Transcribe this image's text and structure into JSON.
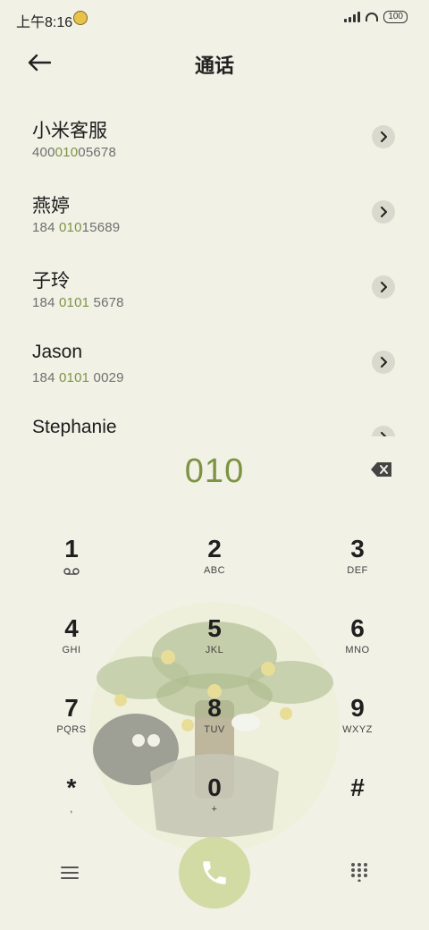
{
  "status": {
    "time": "上午8:16",
    "battery": "100"
  },
  "header": {
    "title": "通话"
  },
  "contacts": [
    {
      "name": "小米客服",
      "number_pre": "400",
      "number_hl": "010",
      "number_post": "05678"
    },
    {
      "name": "燕婷",
      "number_pre": "184 ",
      "number_hl": "010",
      "number_post": "15689"
    },
    {
      "name": "子玲",
      "number_pre": "184 ",
      "number_hl": "0101",
      "number_post": " 5678"
    },
    {
      "name": "Jason",
      "number_pre": "184 ",
      "number_hl": "0101",
      "number_post": " 0029"
    },
    {
      "name": "Stephanie",
      "number_pre": "",
      "number_hl": "",
      "number_post": ""
    }
  ],
  "dialer": {
    "input": "010"
  },
  "keys": [
    {
      "digit": "1",
      "letters": ""
    },
    {
      "digit": "2",
      "letters": "ABC"
    },
    {
      "digit": "3",
      "letters": "DEF"
    },
    {
      "digit": "4",
      "letters": "GHI"
    },
    {
      "digit": "5",
      "letters": "JKL"
    },
    {
      "digit": "6",
      "letters": "MNO"
    },
    {
      "digit": "7",
      "letters": "PQRS"
    },
    {
      "digit": "8",
      "letters": "TUV"
    },
    {
      "digit": "9",
      "letters": "WXYZ"
    },
    {
      "digit": "*",
      "letters": ","
    },
    {
      "digit": "0",
      "letters": "+"
    },
    {
      "digit": "#",
      "letters": ""
    }
  ],
  "icons": {
    "back": "arrow-left-icon",
    "detail": "chevron-right-icon",
    "backspace": "backspace-icon",
    "voicemail": "voicemail-icon",
    "menu": "menu-icon",
    "call": "phone-icon",
    "keypad": "dialpad-icon"
  },
  "colors": {
    "accent": "#7c9342",
    "call_button": "#d2dba4",
    "background": "#f1f1e6"
  }
}
